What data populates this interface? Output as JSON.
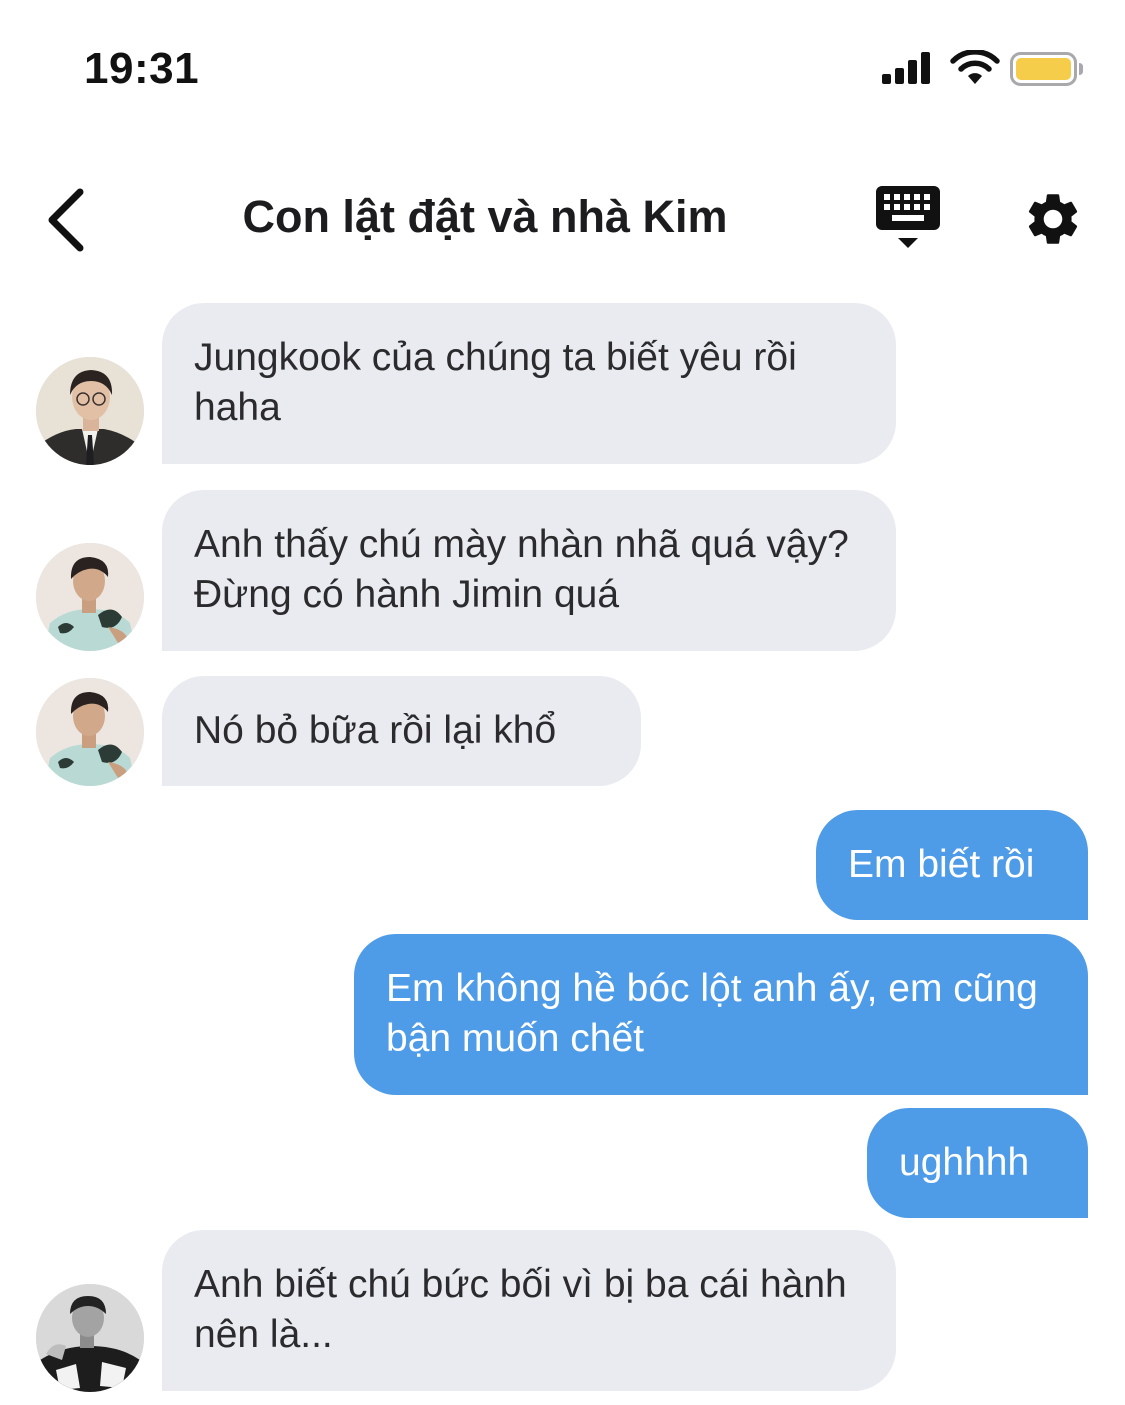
{
  "status_bar": {
    "time": "19:31",
    "battery_color": "#f6cd4b",
    "icons": [
      "signal-icon",
      "wifi-icon",
      "battery-icon"
    ]
  },
  "header": {
    "title": "Con lật đật và nhà Kim",
    "icons": [
      "back-chevron-icon",
      "keyboard-icon",
      "gear-icon"
    ]
  },
  "colors": {
    "incoming_bubble": "#e9ebf0",
    "outgoing_bubble": "#4e9be8"
  },
  "messages": [
    {
      "direction": "incoming",
      "avatar": "avatar-jin",
      "text": "Jungkook của chúng ta biết yêu rồi haha"
    },
    {
      "direction": "incoming",
      "avatar": "avatar-v",
      "text": "Anh thấy chú mày nhàn nhã quá vậy? Đừng có hành Jimin quá"
    },
    {
      "direction": "incoming",
      "avatar": "avatar-v",
      "text": "Nó bỏ bữa rồi lại khổ"
    },
    {
      "direction": "outgoing",
      "text": "Em biết rồi"
    },
    {
      "direction": "outgoing",
      "text": "Em không hề bóc lột anh ấy, em cũng bận muốn chết"
    },
    {
      "direction": "outgoing",
      "text": "ughhhh"
    },
    {
      "direction": "incoming",
      "avatar": "avatar-rm",
      "text": "Anh biết chú bức bối vì bị ba cái hành nên là..."
    }
  ]
}
